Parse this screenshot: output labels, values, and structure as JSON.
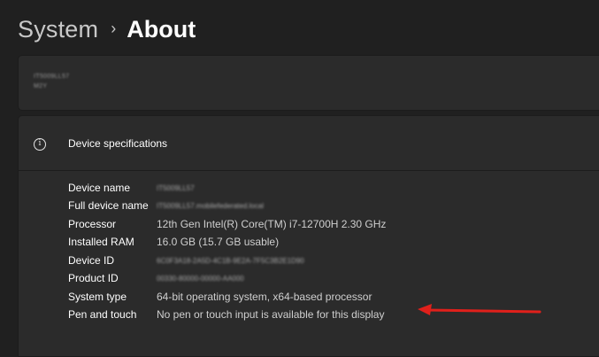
{
  "breadcrumb": {
    "parent": "System",
    "separator": "›",
    "current": "About"
  },
  "device_card": {
    "name": "IT5009LL57",
    "model": "M2Y"
  },
  "specs": {
    "title": "Device specifications",
    "rows": [
      {
        "label": "Device name",
        "value": "IT5009LL57"
      },
      {
        "label": "Full device name",
        "value": "IT5009LL57.mobilefederated.local"
      },
      {
        "label": "Processor",
        "value": "12th Gen Intel(R) Core(TM) i7-12700H   2.30 GHz"
      },
      {
        "label": "Installed RAM",
        "value": "16.0 GB (15.7 GB usable)"
      },
      {
        "label": "Device ID",
        "value": "6C0F3A18-2A5D-4C1B-9E2A-7F5C3B2E1D90"
      },
      {
        "label": "Product ID",
        "value": "00330-80000-00000-AA000"
      },
      {
        "label": "System type",
        "value": "64-bit operating system, x64-based processor"
      },
      {
        "label": "Pen and touch",
        "value": "No pen or touch input is available for this display"
      }
    ]
  },
  "colors": {
    "background": "#202020",
    "card": "#2b2b2b",
    "annotation_arrow": "#e0201b"
  },
  "icons": {
    "info": "info-circle-icon",
    "arrow": "red-arrow-annotation"
  }
}
